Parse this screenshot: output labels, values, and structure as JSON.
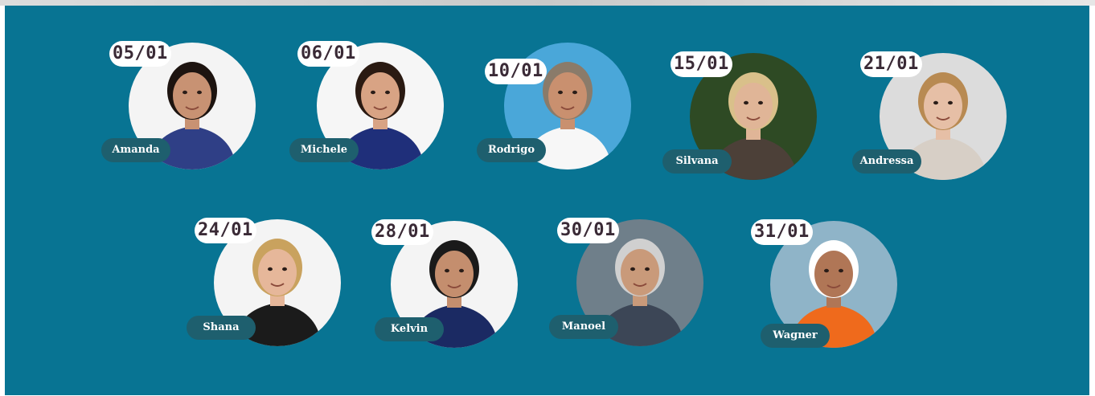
{
  "colors": {
    "panel": "#087493",
    "name_pill": "#1e5f6e",
    "date_pill": "#ffffff",
    "date_text": "#3a2a36"
  },
  "birthdays": [
    {
      "date": "05/01",
      "name": "Amanda",
      "photo_bg": "#f4f4f4",
      "shirt": "#2f3f86",
      "hair": "#1d1410",
      "skin": "#c89273"
    },
    {
      "date": "06/01",
      "name": "Michele",
      "photo_bg": "#f6f6f6",
      "shirt": "#1f2f7a",
      "hair": "#2a1a12",
      "skin": "#d8a384"
    },
    {
      "date": "10/01",
      "name": "Rodrigo",
      "photo_bg": "#4aa7d9",
      "shirt": "#f7f7f7",
      "hair": "#8a7b6a",
      "skin": "#c9906f"
    },
    {
      "date": "15/01",
      "name": "Silvana",
      "photo_bg": "#2e4a24",
      "shirt": "#4c4038",
      "hair": "#d9c08a",
      "skin": "#e0b597"
    },
    {
      "date": "21/01",
      "name": "Andressa",
      "photo_bg": "#dcdcdc",
      "shirt": "#d7cfc6",
      "hair": "#b88a52",
      "skin": "#e6bfa6"
    },
    {
      "date": "24/01",
      "name": "Shana",
      "photo_bg": "#f4f4f4",
      "shirt": "#1b1b1b",
      "hair": "#c9a25e",
      "skin": "#e6b79a"
    },
    {
      "date": "28/01",
      "name": "Kelvin",
      "photo_bg": "#f4f4f4",
      "shirt": "#1b2a63",
      "hair": "#1a1a1a",
      "skin": "#c48e6e"
    },
    {
      "date": "30/01",
      "name": "Manoel",
      "photo_bg": "#6f7f8a",
      "shirt": "#3c4656",
      "hair": "#d0d0d0",
      "skin": "#c99a7a"
    },
    {
      "date": "31/01",
      "name": "Wagner",
      "photo_bg": "#8fb4c8",
      "shirt": "#ef6a1c",
      "hair": "#ffffff",
      "skin": "#b07656"
    }
  ]
}
